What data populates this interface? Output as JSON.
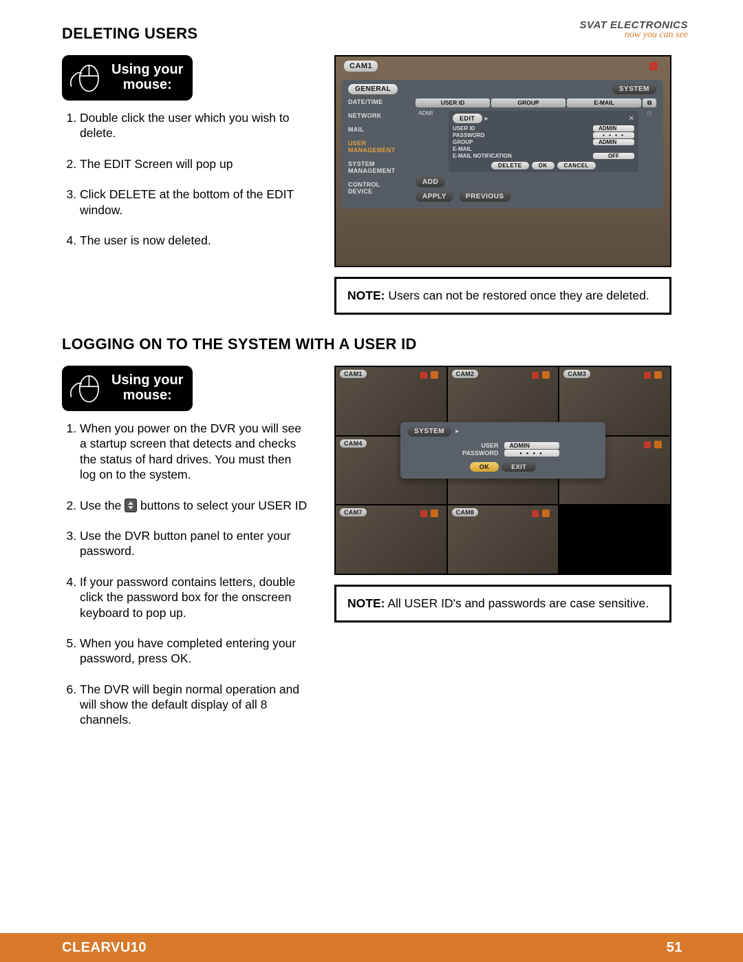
{
  "brand": {
    "top": "SVAT ELECTRONICS",
    "bottom": "now you can see"
  },
  "section1": {
    "title": "DELETING USERS",
    "mouse_label": "Using your\nmouse:",
    "steps": [
      "Double click the user which you wish to delete.",
      "The EDIT Screen will pop up",
      "Click DELETE at the bottom of the EDIT window.",
      "The user is now deleted."
    ],
    "note_label": "NOTE:",
    "note_text": " Users can not be restored once they are deleted."
  },
  "dvr1": {
    "cam": "CAM1",
    "general": "GENERAL",
    "system": "SYSTEM",
    "side": [
      "DATE/TIME",
      "NETWORK",
      "MAIL",
      "USER\nMANAGEMENT",
      "SYSTEM\nMANAGEMENT",
      "CONTROL\nDEVICE"
    ],
    "th": [
      "USER ID",
      "GROUP",
      "E-MAIL"
    ],
    "row1": [
      "ADMI"
    ],
    "edit_label": "EDIT",
    "fields": {
      "user_id_k": "USER ID",
      "user_id_v": "ADMIN",
      "password_k": "PASSWORD",
      "password_v": "• • • •",
      "group_k": "GROUP",
      "group_v": "ADMIN",
      "email_k": "E-MAIL",
      "email_v": "",
      "notif_k": "E-MAIL NOTIFICATION",
      "notif_v": "OFF"
    },
    "btns": {
      "delete": "DELETE",
      "ok": "OK",
      "cancel": "CANCEL",
      "add": "ADD",
      "apply": "APPLY",
      "previous": "PREVIOUS"
    }
  },
  "section2": {
    "title": "LOGGING ON TO THE SYSTEM WITH A USER ID",
    "mouse_label": "Using your\nmouse:",
    "steps": [
      "When you power on the DVR you will see a startup screen that detects and checks the status of hard drives. You must then log on to the system.",
      "Use the __STEPPER__ buttons to select your USER ID",
      "Use the DVR button panel to enter your password.",
      "If your password contains letters, double click the password box for the onscreen keyboard to pop up.",
      "When you have completed entering your password, press OK.",
      "The DVR will begin normal operation and will show the default display of all 8 channels."
    ],
    "note_label": "NOTE:",
    "note_text": " All USER ID's and passwords are case sensitive."
  },
  "dvr2": {
    "cams": [
      "CAM1",
      "CAM2",
      "CAM3",
      "CAM4",
      "",
      "",
      "CAM7",
      "CAM8",
      ""
    ],
    "system": "SYSTEM",
    "user_k": "USER",
    "user_v": "ADMIN",
    "pass_k": "PASSWORD",
    "pass_v": "• • • •",
    "ok": "OK",
    "exit": "EXIT"
  },
  "footer": {
    "model": "CLEARVU10",
    "page": "51"
  }
}
